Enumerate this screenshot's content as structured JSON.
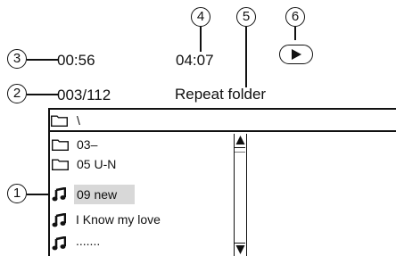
{
  "callouts": [
    "1",
    "2",
    "3",
    "4",
    "5",
    "6"
  ],
  "status": {
    "elapsed_time": "00:56",
    "total_time": "04:07",
    "track_position": "003/112",
    "repeat_mode": "Repeat folder"
  },
  "path": {
    "current_folder": "\\"
  },
  "file_list": [
    {
      "type": "folder",
      "name": "03–"
    },
    {
      "type": "folder",
      "name": "05 U-N"
    },
    {
      "type": "music",
      "name": "09 new",
      "selected": true
    },
    {
      "type": "music",
      "name": "I Know my love"
    },
    {
      "type": "music",
      "name": "......."
    }
  ],
  "icons": {
    "play": "play-icon",
    "folder": "folder-icon",
    "music": "music-note-icon",
    "scroll_up": "triangle-up-icon",
    "scroll_down": "triangle-down-icon"
  }
}
